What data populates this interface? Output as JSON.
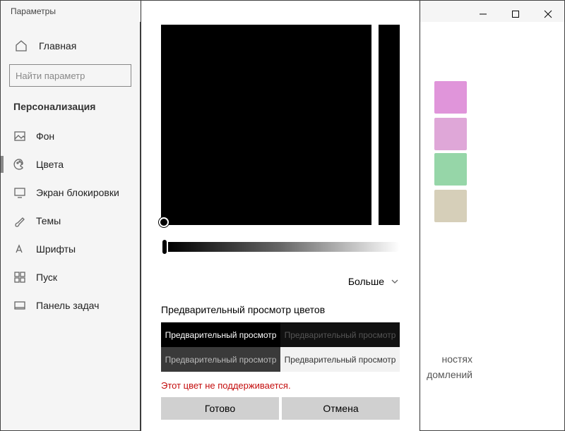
{
  "window": {
    "title": "Параметры"
  },
  "win_controls": {
    "min": "minimize",
    "max": "maximize",
    "close": "close"
  },
  "sidebar": {
    "home": "Главная",
    "search_placeholder": "Найти параметр",
    "section": "Персонализация",
    "items": [
      {
        "icon": "image-icon",
        "label": "Фон"
      },
      {
        "icon": "palette-icon",
        "label": "Цвета",
        "active": true
      },
      {
        "icon": "monitor-icon",
        "label": "Экран блокировки"
      },
      {
        "icon": "brush-icon",
        "label": "Темы"
      },
      {
        "icon": "font-icon",
        "label": "Шрифты"
      },
      {
        "icon": "start-icon",
        "label": "Пуск"
      },
      {
        "icon": "taskbar-icon",
        "label": "Панель задач"
      }
    ]
  },
  "bg": {
    "swatches": [
      "#e095da",
      "#dfa7d8",
      "#96d6a8",
      "#d6cfb9"
    ],
    "text1": "ностях",
    "text2": "домлений"
  },
  "picker": {
    "more": "Больше",
    "preview_header": "Предварительный просмотр цветов",
    "preview_label": "Предварительный просмотр",
    "error": "Этот цвет не поддерживается.",
    "done": "Готово",
    "cancel": "Отмена"
  }
}
